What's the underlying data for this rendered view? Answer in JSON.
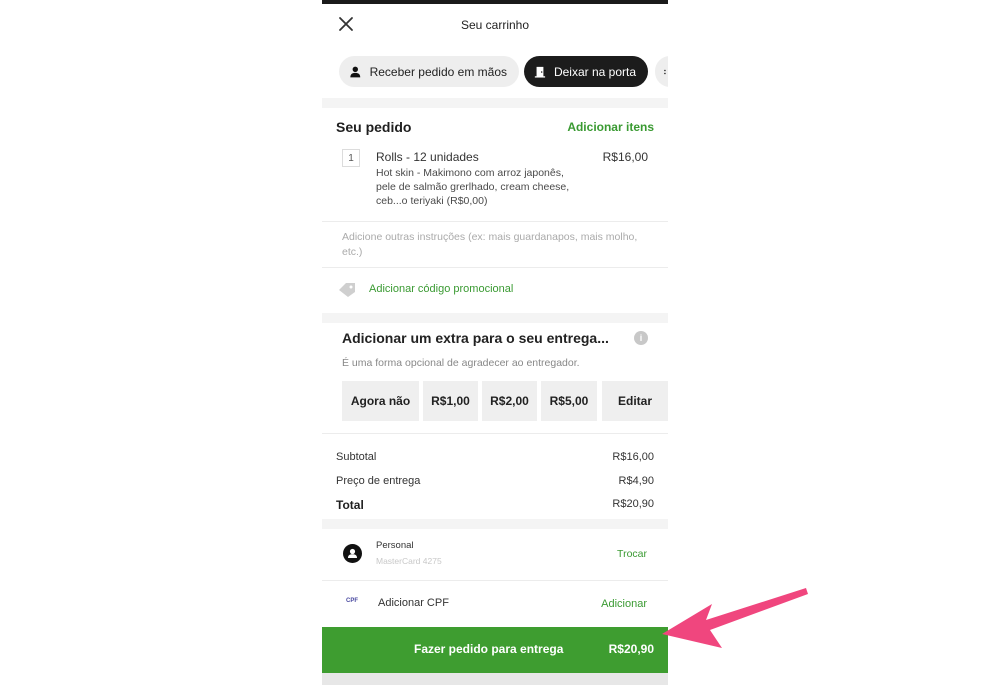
{
  "header": {
    "title": "Seu carrinho",
    "close_icon": "close-icon"
  },
  "delivery_options": [
    {
      "label": "Receber pedido em mãos",
      "icon": "person-icon",
      "selected": false
    },
    {
      "label": "Deixar na porta",
      "icon": "door-icon",
      "selected": true
    }
  ],
  "order": {
    "title": "Seu pedido",
    "add_items_label": "Adicionar itens",
    "item": {
      "quantity": "1",
      "name": "Rolls - 12 unidades",
      "description": "Hot skin - Makimono com arroz japonês, pele de salmão grerlhado, cream cheese, ceb...o teriyaki (R$0,00)",
      "price": "R$16,00"
    },
    "instructions_placeholder": "Adicione outras instruções (ex: mais guardanapos, mais molho, etc.)"
  },
  "promo": {
    "label": "Adicionar código promocional",
    "icon": "tag-icon"
  },
  "tip": {
    "title": "Adicionar um extra para o seu entrega...",
    "subtitle": "É uma forma opcional de agradecer ao entregador.",
    "options": [
      "Agora não",
      "R$1,00",
      "R$2,00",
      "R$5,00",
      "Editar"
    ]
  },
  "summary": {
    "subtotal_label": "Subtotal",
    "subtotal_value": "R$16,00",
    "delivery_label": "Preço de entrega",
    "delivery_value": "R$4,90",
    "total_label": "Total",
    "total_value": "R$20,90"
  },
  "payment": {
    "name": "Personal",
    "card": "MasterCard 4275",
    "change_label": "Trocar"
  },
  "cpf": {
    "icon_text": "CPF",
    "label": "Adicionar CPF",
    "add_label": "Adicionar"
  },
  "checkout": {
    "label": "Fazer pedido para entrega",
    "price": "R$20,90"
  },
  "colors": {
    "accent_green": "#3e9d30",
    "link_green": "#3a9a32",
    "annotation_arrow": "#f0467e"
  }
}
